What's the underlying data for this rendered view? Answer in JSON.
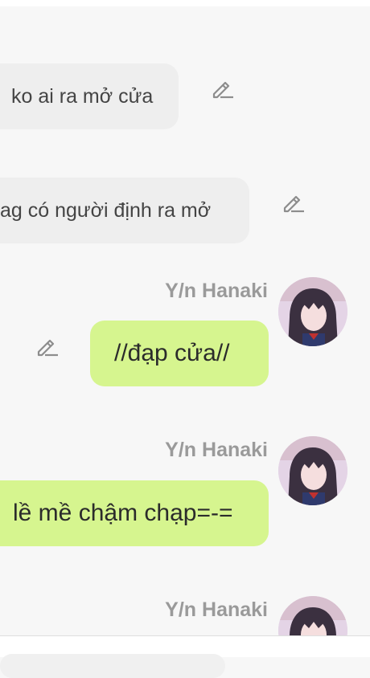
{
  "messages": [
    {
      "text": "ko ai ra mở cửa",
      "direction": "incoming"
    },
    {
      "text": "ag có người định ra mở",
      "direction": "incoming"
    },
    {
      "sender": "Y/n Hanaki",
      "text": "//đạp cửa//",
      "direction": "outgoing"
    },
    {
      "sender": "Y/n Hanaki",
      "text": "lề mề chậm chạp=-=",
      "direction": "outgoing"
    },
    {
      "sender": "Y/n Hanaki",
      "direction": "outgoing"
    }
  ],
  "icons": {
    "edit": "pencil-edit-icon"
  },
  "colors": {
    "background": "#f7f7f7",
    "incoming_bubble": "#eeeeee",
    "outgoing_bubble": "#d6f58f",
    "sender_name": "#9a9a9a",
    "edit_icon": "#8d8d8d"
  }
}
